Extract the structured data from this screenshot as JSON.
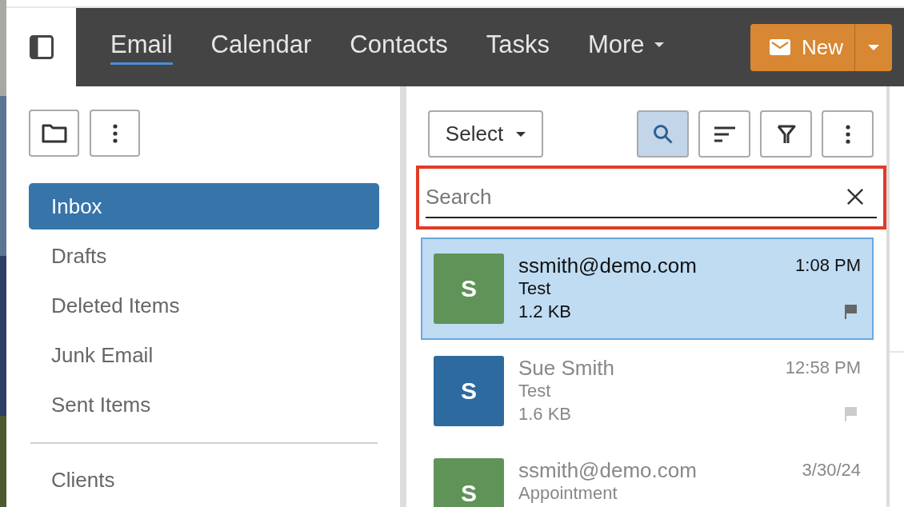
{
  "nav": {
    "tabs": [
      {
        "label": "Email",
        "selected": true
      },
      {
        "label": "Calendar",
        "selected": false
      },
      {
        "label": "Contacts",
        "selected": false
      },
      {
        "label": "Tasks",
        "selected": false
      },
      {
        "label": "More",
        "selected": false,
        "dropdown": true
      }
    ],
    "new_button": {
      "label": "New"
    }
  },
  "sidebar": {
    "items": [
      {
        "label": "Inbox",
        "selected": true
      },
      {
        "label": "Drafts",
        "selected": false
      },
      {
        "label": "Deleted Items",
        "selected": false
      },
      {
        "label": "Junk Email",
        "selected": false
      },
      {
        "label": "Sent Items",
        "selected": false
      }
    ],
    "other_items": [
      {
        "label": "Clients",
        "selected": false
      }
    ]
  },
  "list": {
    "select_button": "Select",
    "search": {
      "placeholder": "Search",
      "highlighted": true
    },
    "toolbar": [
      {
        "kind": "search",
        "selected": true
      },
      {
        "kind": "sort",
        "selected": false
      },
      {
        "kind": "filter",
        "selected": false
      },
      {
        "kind": "more",
        "selected": false
      }
    ],
    "messages": [
      {
        "initial": "S",
        "color": "#5f9358",
        "sender": "ssmith@demo.com",
        "subject": "Test",
        "size": "1.2 KB",
        "time": "1:08 PM",
        "selected": true
      },
      {
        "initial": "S",
        "color": "#2d6aa0",
        "sender": "Sue Smith",
        "subject": "Test",
        "size": "1.6 KB",
        "time": "12:58 PM",
        "selected": false
      },
      {
        "initial": "S",
        "color": "#5f9358",
        "sender": "ssmith@demo.com",
        "subject": "Appointment",
        "time": "3/30/24",
        "selected": false
      }
    ]
  }
}
